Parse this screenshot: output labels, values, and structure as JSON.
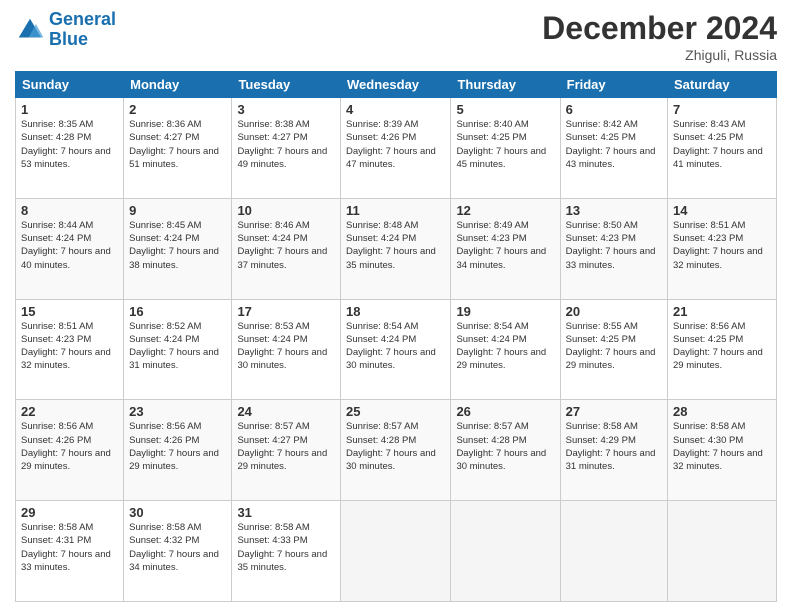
{
  "header": {
    "logo_line1": "General",
    "logo_line2": "Blue",
    "month": "December 2024",
    "location": "Zhiguli, Russia"
  },
  "columns": [
    "Sunday",
    "Monday",
    "Tuesday",
    "Wednesday",
    "Thursday",
    "Friday",
    "Saturday"
  ],
  "weeks": [
    [
      {
        "day": "1",
        "sunrise": "Sunrise: 8:35 AM",
        "sunset": "Sunset: 4:28 PM",
        "daylight": "Daylight: 7 hours and 53 minutes."
      },
      {
        "day": "2",
        "sunrise": "Sunrise: 8:36 AM",
        "sunset": "Sunset: 4:27 PM",
        "daylight": "Daylight: 7 hours and 51 minutes."
      },
      {
        "day": "3",
        "sunrise": "Sunrise: 8:38 AM",
        "sunset": "Sunset: 4:27 PM",
        "daylight": "Daylight: 7 hours and 49 minutes."
      },
      {
        "day": "4",
        "sunrise": "Sunrise: 8:39 AM",
        "sunset": "Sunset: 4:26 PM",
        "daylight": "Daylight: 7 hours and 47 minutes."
      },
      {
        "day": "5",
        "sunrise": "Sunrise: 8:40 AM",
        "sunset": "Sunset: 4:25 PM",
        "daylight": "Daylight: 7 hours and 45 minutes."
      },
      {
        "day": "6",
        "sunrise": "Sunrise: 8:42 AM",
        "sunset": "Sunset: 4:25 PM",
        "daylight": "Daylight: 7 hours and 43 minutes."
      },
      {
        "day": "7",
        "sunrise": "Sunrise: 8:43 AM",
        "sunset": "Sunset: 4:25 PM",
        "daylight": "Daylight: 7 hours and 41 minutes."
      }
    ],
    [
      {
        "day": "8",
        "sunrise": "Sunrise: 8:44 AM",
        "sunset": "Sunset: 4:24 PM",
        "daylight": "Daylight: 7 hours and 40 minutes."
      },
      {
        "day": "9",
        "sunrise": "Sunrise: 8:45 AM",
        "sunset": "Sunset: 4:24 PM",
        "daylight": "Daylight: 7 hours and 38 minutes."
      },
      {
        "day": "10",
        "sunrise": "Sunrise: 8:46 AM",
        "sunset": "Sunset: 4:24 PM",
        "daylight": "Daylight: 7 hours and 37 minutes."
      },
      {
        "day": "11",
        "sunrise": "Sunrise: 8:48 AM",
        "sunset": "Sunset: 4:24 PM",
        "daylight": "Daylight: 7 hours and 35 minutes."
      },
      {
        "day": "12",
        "sunrise": "Sunrise: 8:49 AM",
        "sunset": "Sunset: 4:23 PM",
        "daylight": "Daylight: 7 hours and 34 minutes."
      },
      {
        "day": "13",
        "sunrise": "Sunrise: 8:50 AM",
        "sunset": "Sunset: 4:23 PM",
        "daylight": "Daylight: 7 hours and 33 minutes."
      },
      {
        "day": "14",
        "sunrise": "Sunrise: 8:51 AM",
        "sunset": "Sunset: 4:23 PM",
        "daylight": "Daylight: 7 hours and 32 minutes."
      }
    ],
    [
      {
        "day": "15",
        "sunrise": "Sunrise: 8:51 AM",
        "sunset": "Sunset: 4:23 PM",
        "daylight": "Daylight: 7 hours and 32 minutes."
      },
      {
        "day": "16",
        "sunrise": "Sunrise: 8:52 AM",
        "sunset": "Sunset: 4:24 PM",
        "daylight": "Daylight: 7 hours and 31 minutes."
      },
      {
        "day": "17",
        "sunrise": "Sunrise: 8:53 AM",
        "sunset": "Sunset: 4:24 PM",
        "daylight": "Daylight: 7 hours and 30 minutes."
      },
      {
        "day": "18",
        "sunrise": "Sunrise: 8:54 AM",
        "sunset": "Sunset: 4:24 PM",
        "daylight": "Daylight: 7 hours and 30 minutes."
      },
      {
        "day": "19",
        "sunrise": "Sunrise: 8:54 AM",
        "sunset": "Sunset: 4:24 PM",
        "daylight": "Daylight: 7 hours and 29 minutes."
      },
      {
        "day": "20",
        "sunrise": "Sunrise: 8:55 AM",
        "sunset": "Sunset: 4:25 PM",
        "daylight": "Daylight: 7 hours and 29 minutes."
      },
      {
        "day": "21",
        "sunrise": "Sunrise: 8:56 AM",
        "sunset": "Sunset: 4:25 PM",
        "daylight": "Daylight: 7 hours and 29 minutes."
      }
    ],
    [
      {
        "day": "22",
        "sunrise": "Sunrise: 8:56 AM",
        "sunset": "Sunset: 4:26 PM",
        "daylight": "Daylight: 7 hours and 29 minutes."
      },
      {
        "day": "23",
        "sunrise": "Sunrise: 8:56 AM",
        "sunset": "Sunset: 4:26 PM",
        "daylight": "Daylight: 7 hours and 29 minutes."
      },
      {
        "day": "24",
        "sunrise": "Sunrise: 8:57 AM",
        "sunset": "Sunset: 4:27 PM",
        "daylight": "Daylight: 7 hours and 29 minutes."
      },
      {
        "day": "25",
        "sunrise": "Sunrise: 8:57 AM",
        "sunset": "Sunset: 4:28 PM",
        "daylight": "Daylight: 7 hours and 30 minutes."
      },
      {
        "day": "26",
        "sunrise": "Sunrise: 8:57 AM",
        "sunset": "Sunset: 4:28 PM",
        "daylight": "Daylight: 7 hours and 30 minutes."
      },
      {
        "day": "27",
        "sunrise": "Sunrise: 8:58 AM",
        "sunset": "Sunset: 4:29 PM",
        "daylight": "Daylight: 7 hours and 31 minutes."
      },
      {
        "day": "28",
        "sunrise": "Sunrise: 8:58 AM",
        "sunset": "Sunset: 4:30 PM",
        "daylight": "Daylight: 7 hours and 32 minutes."
      }
    ],
    [
      {
        "day": "29",
        "sunrise": "Sunrise: 8:58 AM",
        "sunset": "Sunset: 4:31 PM",
        "daylight": "Daylight: 7 hours and 33 minutes."
      },
      {
        "day": "30",
        "sunrise": "Sunrise: 8:58 AM",
        "sunset": "Sunset: 4:32 PM",
        "daylight": "Daylight: 7 hours and 34 minutes."
      },
      {
        "day": "31",
        "sunrise": "Sunrise: 8:58 AM",
        "sunset": "Sunset: 4:33 PM",
        "daylight": "Daylight: 7 hours and 35 minutes."
      },
      null,
      null,
      null,
      null
    ]
  ]
}
